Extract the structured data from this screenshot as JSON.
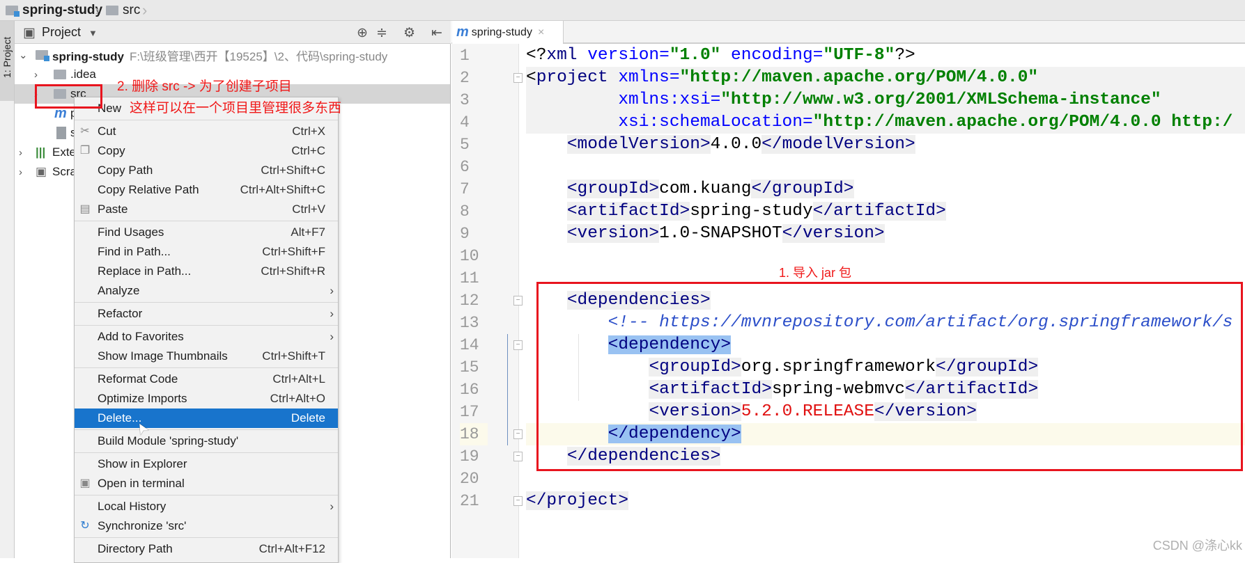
{
  "breadcrumb": [
    {
      "label": "spring-study",
      "icon": "module-folder-icon"
    },
    {
      "label": "src",
      "icon": "folder-icon"
    }
  ],
  "tool_strip": {
    "label": "1: Project"
  },
  "project_panel": {
    "title": "Project",
    "tree": [
      {
        "label": "spring-study",
        "path": "F:\\班级管理\\西开【19525】\\2、代码\\spring-study",
        "expanded": true
      },
      {
        "label": ".idea"
      },
      {
        "label": "src",
        "selected": true
      },
      {
        "label": "p",
        "icon": "maven-icon"
      },
      {
        "label": "s",
        "icon": "iml-file-icon"
      },
      {
        "label": "Exte"
      },
      {
        "label": "Scra"
      }
    ]
  },
  "context_menu": {
    "items": [
      {
        "label": "New",
        "submenu": false
      },
      {
        "label": "Cut",
        "shortcut": "Ctrl+X",
        "icon": "scissors-icon"
      },
      {
        "label": "Copy",
        "shortcut": "Ctrl+C",
        "icon": "copy-icon"
      },
      {
        "label": "Copy Path",
        "shortcut": "Ctrl+Shift+C"
      },
      {
        "label": "Copy Relative Path",
        "shortcut": "Ctrl+Alt+Shift+C"
      },
      {
        "label": "Paste",
        "shortcut": "Ctrl+V",
        "icon": "paste-icon"
      },
      {
        "label": "Find Usages",
        "shortcut": "Alt+F7"
      },
      {
        "label": "Find in Path...",
        "shortcut": "Ctrl+Shift+F"
      },
      {
        "label": "Replace in Path...",
        "shortcut": "Ctrl+Shift+R"
      },
      {
        "label": "Analyze",
        "submenu": true
      },
      {
        "label": "Refactor",
        "submenu": true
      },
      {
        "label": "Add to Favorites",
        "submenu": true
      },
      {
        "label": "Show Image Thumbnails",
        "shortcut": "Ctrl+Shift+T"
      },
      {
        "label": "Reformat Code",
        "shortcut": "Ctrl+Alt+L"
      },
      {
        "label": "Optimize Imports",
        "shortcut": "Ctrl+Alt+O"
      },
      {
        "label": "Delete...",
        "shortcut": "Delete",
        "highlighted": true
      },
      {
        "label": "Build Module 'spring-study'"
      },
      {
        "label": "Show in Explorer"
      },
      {
        "label": "Open in terminal",
        "icon": "terminal-icon"
      },
      {
        "label": "Local History",
        "submenu": true
      },
      {
        "label": "Synchronize 'src'",
        "icon": "sync-icon"
      },
      {
        "label": "Directory Path",
        "shortcut": "Ctrl+Alt+F12"
      }
    ]
  },
  "editor": {
    "tab": {
      "label": "spring-study",
      "icon": "maven-icon"
    },
    "lines": [
      [
        [
          "<?",
          "k"
        ],
        [
          "xml",
          "b"
        ],
        [
          " version=",
          "a"
        ],
        [
          "\"1.0\"",
          "s"
        ],
        [
          " encoding=",
          "a"
        ],
        [
          "\"UTF-8\"",
          "s"
        ],
        [
          "?>",
          "k"
        ]
      ],
      [
        [
          "<",
          "k"
        ],
        [
          "project",
          "b"
        ],
        [
          " xmlns=",
          "a"
        ],
        [
          "\"http://maven.apache.org/POM/4.0.0\"",
          "s"
        ]
      ],
      [
        [
          "         xmlns:xsi=",
          "a"
        ],
        [
          "\"http://www.w3.org/2001/XMLSchema-instance\"",
          "s"
        ]
      ],
      [
        [
          "         xsi:schemaLocation=",
          "a"
        ],
        [
          "\"http://maven.apache.org/POM/4.0.0 http:/",
          "s"
        ]
      ],
      [
        [
          "    ",
          "k"
        ],
        [
          "<modelVersion>",
          "b",
          "g"
        ],
        [
          "4.0.0",
          "k"
        ],
        [
          "</modelVersion>",
          "b",
          "g"
        ]
      ],
      [],
      [
        [
          "    ",
          "k"
        ],
        [
          "<groupId>",
          "b",
          "g"
        ],
        [
          "com.kuang",
          "k"
        ],
        [
          "</groupId>",
          "b",
          "g"
        ]
      ],
      [
        [
          "    ",
          "k"
        ],
        [
          "<artifactId>",
          "b",
          "g"
        ],
        [
          "spring-study",
          "k"
        ],
        [
          "</artifactId>",
          "b",
          "g"
        ]
      ],
      [
        [
          "    ",
          "k"
        ],
        [
          "<version>",
          "b",
          "g"
        ],
        [
          "1.0-SNAPSHOT",
          "k"
        ],
        [
          "</version>",
          "b",
          "g"
        ]
      ],
      [],
      [],
      [
        [
          "    ",
          "k"
        ],
        [
          "<dependencies>",
          "b",
          "g"
        ]
      ],
      [
        [
          "        ",
          "k"
        ],
        [
          "<!-- https://mvnrepository.com/artifact/org.springframework/s",
          "c"
        ]
      ],
      [
        [
          "        ",
          "k"
        ],
        [
          "<dependency>",
          "b",
          "sel"
        ]
      ],
      [
        [
          "            ",
          "k"
        ],
        [
          "<groupId>",
          "b",
          "g"
        ],
        [
          "org.springframework",
          "k"
        ],
        [
          "</groupId>",
          "b",
          "g"
        ]
      ],
      [
        [
          "            ",
          "k"
        ],
        [
          "<artifactId>",
          "b",
          "g"
        ],
        [
          "spring-webmvc",
          "k"
        ],
        [
          "</artifactId>",
          "b",
          "g"
        ]
      ],
      [
        [
          "            ",
          "k"
        ],
        [
          "<version>",
          "b",
          "g"
        ],
        [
          "5.2.0.RELEASE",
          "r"
        ],
        [
          "</version>",
          "b",
          "g"
        ]
      ],
      [
        [
          "        ",
          "k"
        ],
        [
          "</dependency>",
          "b",
          "sel"
        ]
      ],
      [
        [
          "    ",
          "k"
        ],
        [
          "</dependencies>",
          "b",
          "g"
        ]
      ],
      [],
      [
        [
          "</project>",
          "b",
          "g"
        ]
      ]
    ],
    "current_line": 18
  },
  "annotations": {
    "step2_line1": "2. 删除 src -> 为了创建子项目",
    "step2_line2": "这样可以在一个项目里管理很多东西",
    "step1": "1. 导入 jar 包"
  },
  "watermark": "CSDN @涤心kk",
  "colors": {
    "highlight": "#1874cc",
    "annotation": "#e8141e"
  }
}
